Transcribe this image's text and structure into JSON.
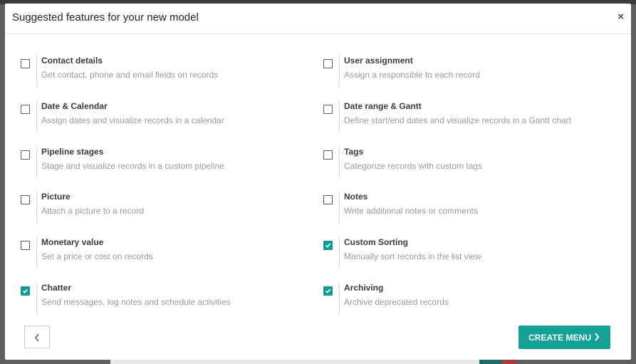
{
  "dialog": {
    "title": "Suggested features for your new model",
    "close_label": "×"
  },
  "features": [
    {
      "title": "Contact details",
      "description": "Get contact, phone and email fields on records",
      "checked": false
    },
    {
      "title": "User assignment",
      "description": "Assign a responsible to each record",
      "checked": false
    },
    {
      "title": "Date & Calendar",
      "description": "Assign dates and visualize records in a calendar",
      "checked": false
    },
    {
      "title": "Date range & Gantt",
      "description": "Define start/end dates and visualize records in a Gantt chart",
      "checked": false
    },
    {
      "title": "Pipeline stages",
      "description": "Stage and visualize records in a custom pipeline",
      "checked": false
    },
    {
      "title": "Tags",
      "description": "Categorize records with custom tags",
      "checked": false
    },
    {
      "title": "Picture",
      "description": "Attach a picture to a record",
      "checked": false
    },
    {
      "title": "Notes",
      "description": "Write additional notes or comments",
      "checked": false
    },
    {
      "title": "Monetary value",
      "description": "Set a price or cost on records",
      "checked": false
    },
    {
      "title": "Custom Sorting",
      "description": "Manually sort records in the list view",
      "checked": true
    },
    {
      "title": "Chatter",
      "description": "Send messages, log notes and schedule activities",
      "checked": true
    },
    {
      "title": "Archiving",
      "description": "Archive deprecated records",
      "checked": true
    }
  ],
  "footer": {
    "back_icon": "chevron-left-icon",
    "create_label": "CREATE MENU",
    "create_icon": "chevron-right-icon"
  },
  "colors": {
    "accent": "#14a198",
    "checkbox_checked": "#0f9a94"
  }
}
